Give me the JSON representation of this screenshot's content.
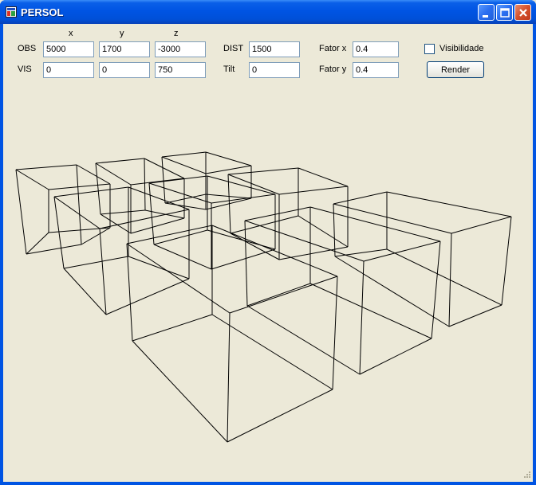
{
  "window": {
    "title": "PERSOL"
  },
  "form": {
    "headers": {
      "x": "x",
      "y": "y",
      "z": "z"
    },
    "obs": {
      "label": "OBS",
      "x": "5000",
      "y": "1700",
      "z": "-3000"
    },
    "vis": {
      "label": "VIS",
      "x": "0",
      "y": "0",
      "z": "750"
    },
    "dist": {
      "label": "DIST",
      "value": "1500"
    },
    "tilt": {
      "label": "Tilt",
      "value": "0"
    },
    "fator_x": {
      "label": "Fator x",
      "value": "0.4"
    },
    "fator_y": {
      "label": "Fator y",
      "value": "0.4"
    },
    "visibilidade": {
      "label": "Visibilidade",
      "checked": false
    },
    "render_label": "Render"
  },
  "colors": {
    "titlebar": "#0054E3",
    "face": "#ECE9D8",
    "wire": "#000000"
  },
  "icons": [
    "app-icon",
    "minimize-icon",
    "maximize-icon",
    "close-icon",
    "resize-grip-icon"
  ]
}
